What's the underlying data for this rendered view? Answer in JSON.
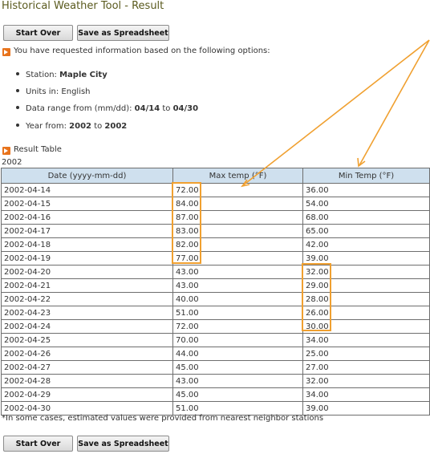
{
  "page": {
    "title": "Historical Weather Tool - Result"
  },
  "buttons": {
    "start_over": "Start Over",
    "save_spreadsheet": "Save as Spreadsheet"
  },
  "intro": "You have requested information based on the following options:",
  "options": {
    "station_label": "Station: ",
    "station_value": "Maple City",
    "units_label": "Units in: English",
    "range_label": "Data range from (mm/dd): ",
    "range_from": "04/14",
    "range_to_word": " to ",
    "range_to": "04/30",
    "year_label": "Year from: ",
    "year_from": "2002",
    "year_to_word": " to ",
    "year_to": "2002"
  },
  "result_heading": "Result Table",
  "year_caption": "2002",
  "table": {
    "headers": [
      "Date (yyyy-mm-dd)",
      "Max temp (°F)",
      "Min Temp (°F)"
    ],
    "rows": [
      [
        "2002-04-14",
        "72.00",
        "36.00"
      ],
      [
        "2002-04-15",
        "84.00",
        "54.00"
      ],
      [
        "2002-04-16",
        "87.00",
        "68.00"
      ],
      [
        "2002-04-17",
        "83.00",
        "65.00"
      ],
      [
        "2002-04-18",
        "82.00",
        "42.00"
      ],
      [
        "2002-04-19",
        "77.00",
        "39.00"
      ],
      [
        "2002-04-20",
        "43.00",
        "32.00"
      ],
      [
        "2002-04-21",
        "43.00",
        "29.00"
      ],
      [
        "2002-04-22",
        "40.00",
        "28.00"
      ],
      [
        "2002-04-23",
        "51.00",
        "26.00"
      ],
      [
        "2002-04-24",
        "72.00",
        "30.00"
      ],
      [
        "2002-04-25",
        "70.00",
        "34.00"
      ],
      [
        "2002-04-26",
        "44.00",
        "25.00"
      ],
      [
        "2002-04-27",
        "45.00",
        "27.00"
      ],
      [
        "2002-04-28",
        "43.00",
        "32.00"
      ],
      [
        "2002-04-29",
        "45.00",
        "34.00"
      ],
      [
        "2002-04-30",
        "51.00",
        "39.00"
      ]
    ]
  },
  "footnote": "*In some cases, estimated values were provided from nearest neighbor stations",
  "colors": {
    "accent": "#e8731c",
    "highlight": "#f0a030",
    "header_bg": "#cfe0ee",
    "title": "#5a5a1e"
  },
  "icons": {
    "bullet": "orange-arrow-bullet-icon"
  }
}
